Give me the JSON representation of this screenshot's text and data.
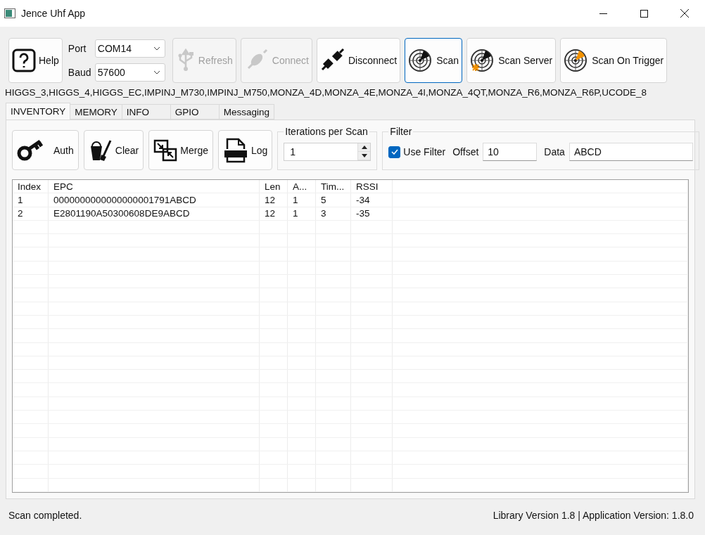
{
  "window": {
    "title": "Jence Uhf App"
  },
  "toolbar": {
    "help": {
      "label": "Help"
    },
    "port": {
      "label": "Port",
      "value": "COM14"
    },
    "baud": {
      "label": "Baud",
      "value": "57600"
    },
    "buttons": [
      {
        "kind": "usb",
        "label": "Refresh",
        "disabled": true,
        "focused": false
      },
      {
        "kind": "plug",
        "label": "Connect",
        "disabled": true,
        "focused": false
      },
      {
        "kind": "unplug",
        "label": "Disconnect",
        "disabled": false,
        "focused": false
      },
      {
        "kind": "radar",
        "label": "Scan",
        "disabled": false,
        "focused": true
      },
      {
        "kind": "radar-star",
        "label": "Scan Server",
        "disabled": false,
        "focused": false
      },
      {
        "kind": "radar-flag",
        "label": "Scan On Trigger",
        "disabled": false,
        "focused": false
      }
    ]
  },
  "tag_types": "HIGGS_3,HIGGS_4,HIGGS_EC,IMPINJ_M730,IMPINJ_M750,MONZA_4D,MONZA_4E,MONZA_4I,MONZA_4QT,MONZA_R6,MONZA_R6P,UCODE_8",
  "tabs": [
    {
      "label": "INVENTORY",
      "selected": true
    },
    {
      "label": "MEMORY",
      "selected": false
    },
    {
      "label": "INFO",
      "selected": false
    },
    {
      "label": "GPIO",
      "selected": false
    },
    {
      "label": "Messaging",
      "selected": false
    }
  ],
  "actions": [
    {
      "kind": "key",
      "label": "Auth"
    },
    {
      "kind": "bucket",
      "label": "Clear"
    },
    {
      "kind": "merge",
      "label": "Merge"
    },
    {
      "kind": "log",
      "label": "Log"
    }
  ],
  "iterations": {
    "title": "Iterations per Scan",
    "value": "1"
  },
  "filter": {
    "title": "Filter",
    "use_filter": {
      "label": "Use Filter",
      "checked": true
    },
    "offset": {
      "label": "Offset",
      "value": "10"
    },
    "data": {
      "label": "Data",
      "value": "ABCD"
    }
  },
  "table": {
    "columns": [
      "Index",
      "EPC",
      "Len",
      "A...",
      "Tim...",
      "RSSI"
    ],
    "rows": [
      [
        "1",
        "0000000000000000001791ABCD",
        "12",
        "1",
        "5",
        "-34"
      ],
      [
        "2",
        "E2801190A50300608DE9ABCD",
        "12",
        "1",
        "3",
        "-35"
      ]
    ]
  },
  "status_bar": {
    "message": "Scan completed.",
    "versions": "Library Version 1.8 | Application Version: 1.8.0"
  }
}
